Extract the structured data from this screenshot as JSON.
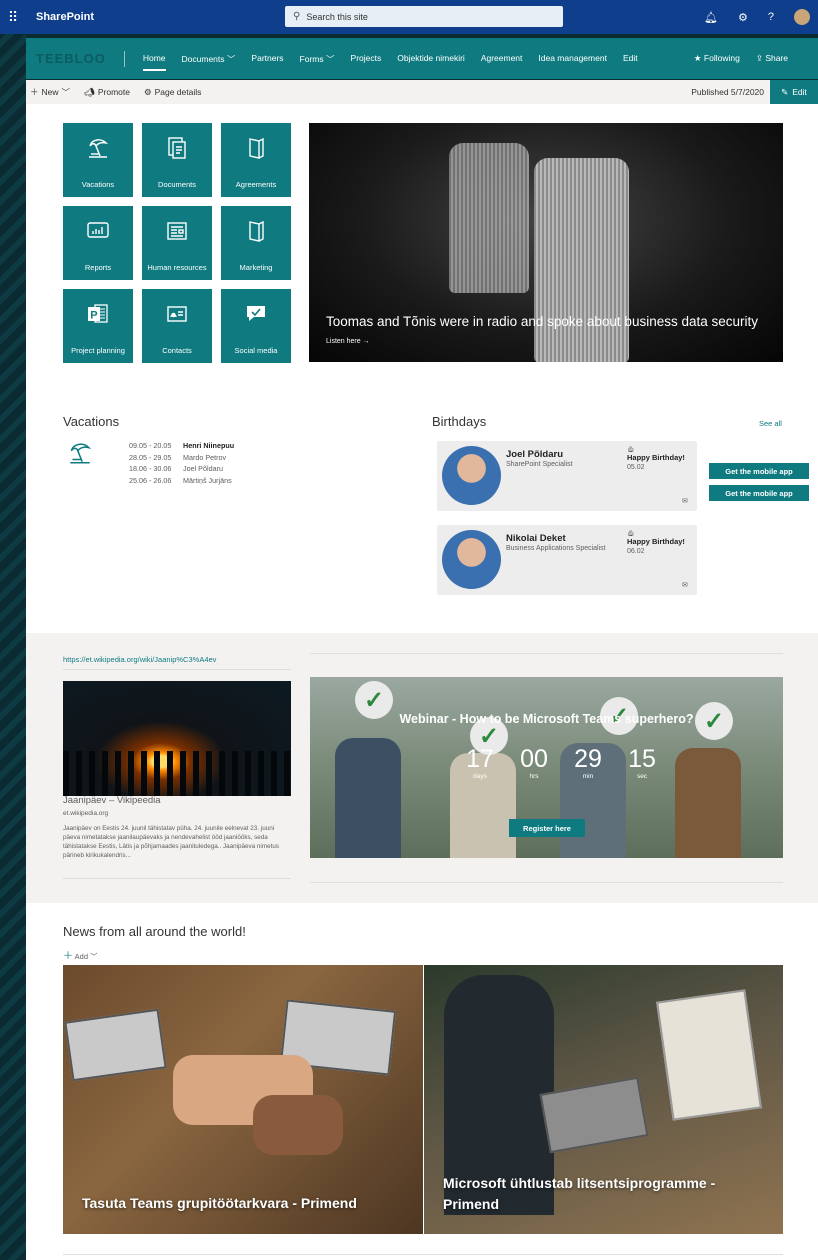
{
  "suitebar": {
    "app_name": "SharePoint",
    "search_placeholder": "Search this site",
    "help_label": "?"
  },
  "navbar": {
    "logo_text": "TEEBLOO",
    "links": [
      "Home",
      "Documents",
      "Partners",
      "Forms",
      "Projects",
      "Objektide nimekiri",
      "Agreement",
      "Idea management",
      "Edit"
    ],
    "following_label": "Following",
    "share_label": "Share"
  },
  "commandbar": {
    "new_label": "New",
    "promote_label": "Promote",
    "page_details_label": "Page details",
    "published_label": "Published 5/7/2020",
    "edit_label": "Edit"
  },
  "tiles": [
    {
      "label": "Vacations",
      "icon": "beach-umbrella-icon"
    },
    {
      "label": "Documents",
      "icon": "document-icon"
    },
    {
      "label": "Agreements",
      "icon": "book-icon"
    },
    {
      "label": "Reports",
      "icon": "chart-icon"
    },
    {
      "label": "Human resources",
      "icon": "news-icon"
    },
    {
      "label": "Marketing",
      "icon": "book-icon"
    },
    {
      "label": "Project planning",
      "icon": "project-icon"
    },
    {
      "label": "Contacts",
      "icon": "contact-card-icon"
    },
    {
      "label": "Social media",
      "icon": "chat-icon"
    }
  ],
  "hero": {
    "title": "Toomas and Tõnis were in radio and spoke about business data security",
    "link": "Listen here →"
  },
  "vacations": {
    "title": "Vacations",
    "items": [
      {
        "dates": "09.05 - 20.05",
        "name": "Henri Niinepuu"
      },
      {
        "dates": "28.05 - 29.05",
        "name": "Mardo Petrov"
      },
      {
        "dates": "18.06 - 30.06",
        "name": "Joel Põldaru"
      },
      {
        "dates": "25.06 - 26.06",
        "name": "Mārtiņš Jurjāns"
      }
    ]
  },
  "birthdays": {
    "title": "Birthdays",
    "see_all": "See all",
    "people": [
      {
        "name": "Joel Põldaru",
        "job": "SharePoint Specialist",
        "greeting": "Happy Birthday!",
        "date": "05.02"
      },
      {
        "name": "Nikolai Deket",
        "job": "Business Applications Specialist",
        "greeting": "Happy Birthday!",
        "date": "06.02"
      }
    ],
    "mobile_buttons": [
      "Get the mobile app",
      "Get the mobile app"
    ]
  },
  "wiki": {
    "url": "https://et.wikipedia.org/wiki/Jaanip%C3%A4ev",
    "title": "Jaanipäev – Vikipeedia",
    "site": "et.wikipedia.org",
    "description": "Jaanipäev on Eestis 24. juunil tähistatav püha. 24. juunile eelnevat 23. juuni päeva nimetatakse jaanilaupäevaks ja nendevahelist ööd jaaniööks, seda tähistatakse Eestis, Lätis ja põhjamaades jaanituledega.. Jaanipäeva nimetus pärineb kirikukalendris..."
  },
  "webinar": {
    "title": "Webinar - How to be Microsoft Teams superhero?",
    "countdown": [
      {
        "value": "17",
        "label": "days"
      },
      {
        "value": "00",
        "label": "hrs"
      },
      {
        "value": "29",
        "label": "min"
      },
      {
        "value": "15",
        "label": "sec"
      }
    ],
    "register_label": "Register here"
  },
  "news": {
    "title": "News from all around the world!",
    "add_label": "Add",
    "items": [
      {
        "caption": "Tasuta Teams grupitöötarkvara - Primend"
      },
      {
        "caption": "Microsoft ühtlustab litsentsiprogramme - Primend"
      }
    ]
  },
  "colors": {
    "accent": "#0f7b80",
    "suitebar": "#0f3e8c",
    "background": "#0b2b33"
  }
}
